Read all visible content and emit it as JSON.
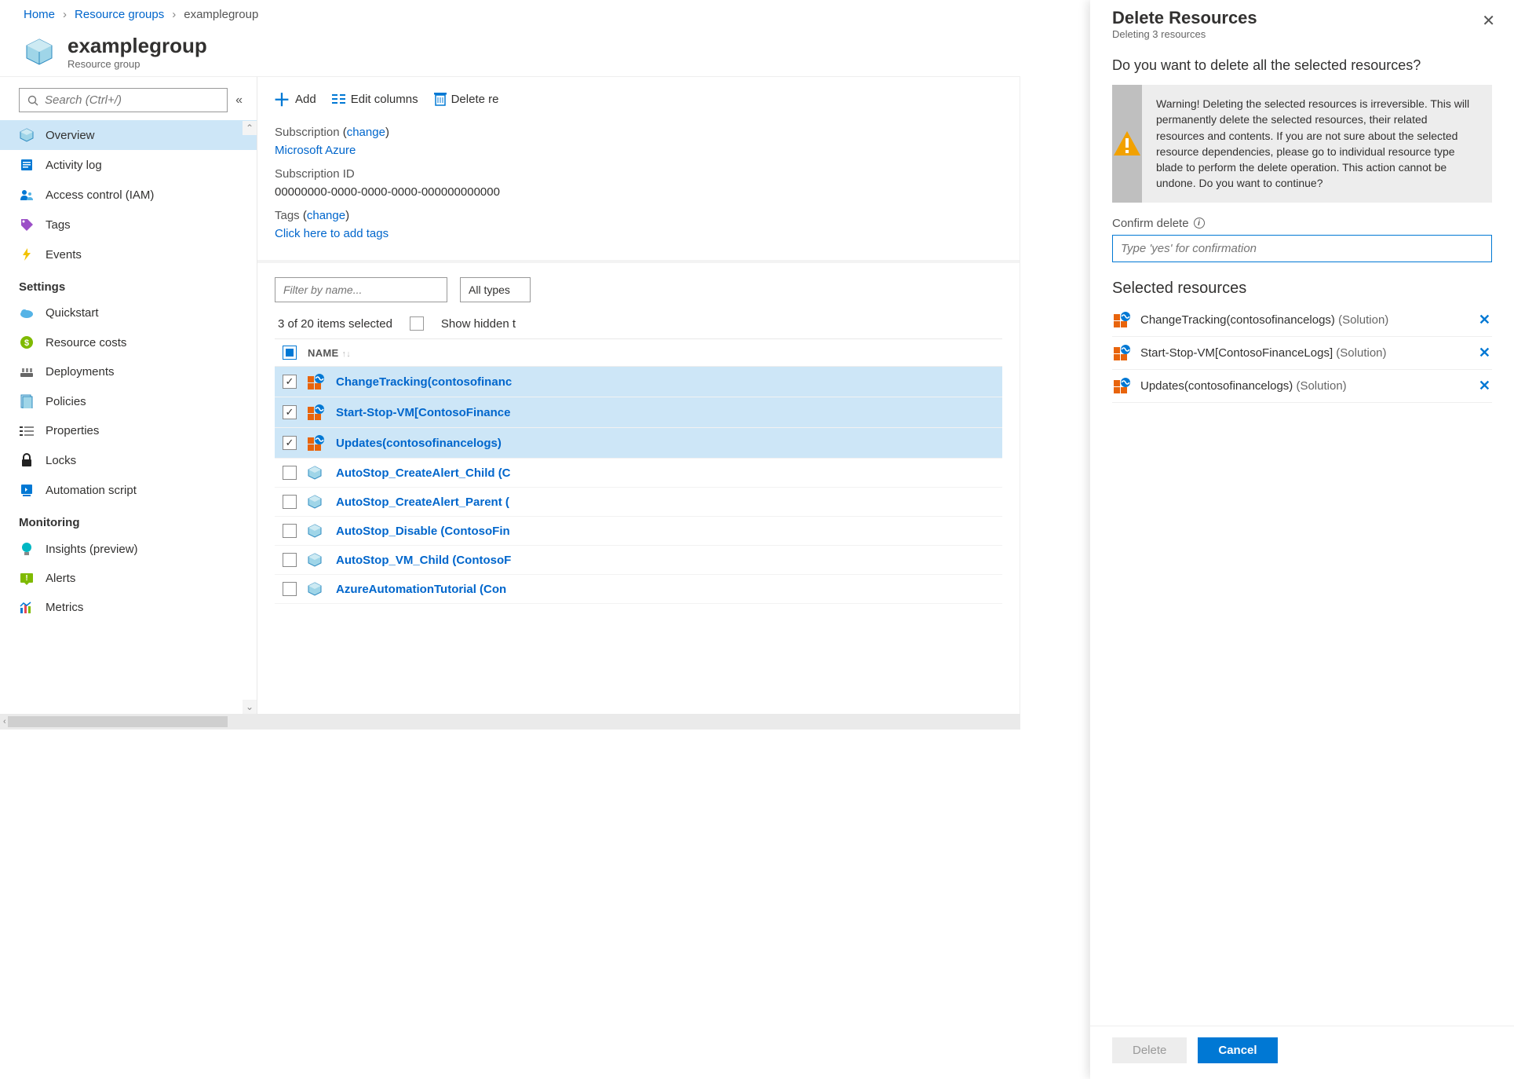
{
  "breadcrumb": {
    "home": "Home",
    "rg": "Resource groups",
    "current": "examplegroup"
  },
  "header": {
    "title": "examplegroup",
    "subtitle": "Resource group"
  },
  "search": {
    "placeholder": "Search (Ctrl+/)"
  },
  "sidebar": {
    "items": [
      {
        "icon": "cube",
        "label": "Overview",
        "active": true
      },
      {
        "icon": "log",
        "label": "Activity log"
      },
      {
        "icon": "iam",
        "label": "Access control (IAM)"
      },
      {
        "icon": "tag",
        "label": "Tags"
      },
      {
        "icon": "bolt",
        "label": "Events"
      }
    ],
    "settings_header": "Settings",
    "settings": [
      {
        "icon": "cloud",
        "label": "Quickstart"
      },
      {
        "icon": "cost",
        "label": "Resource costs"
      },
      {
        "icon": "deploy",
        "label": "Deployments"
      },
      {
        "icon": "policy",
        "label": "Policies"
      },
      {
        "icon": "props",
        "label": "Properties"
      },
      {
        "icon": "lock",
        "label": "Locks"
      },
      {
        "icon": "script",
        "label": "Automation script"
      }
    ],
    "monitoring_header": "Monitoring",
    "monitoring": [
      {
        "icon": "bulb",
        "label": "Insights (preview)"
      },
      {
        "icon": "alert",
        "label": "Alerts"
      },
      {
        "icon": "metrics",
        "label": "Metrics"
      }
    ]
  },
  "toolbar": {
    "add": "Add",
    "edit_columns": "Edit columns",
    "delete": "Delete re"
  },
  "meta": {
    "sub_label": "Subscription",
    "change": "change",
    "sub_value": "Microsoft Azure",
    "subid_label": "Subscription ID",
    "subid_value": "00000000-0000-0000-0000-000000000000",
    "tags_label": "Tags",
    "tags_value": "Click here to add tags"
  },
  "list": {
    "filter_placeholder": "Filter by name...",
    "types_dd": "All types",
    "selected_text": "3 of 20 items selected",
    "show_hidden": "Show hidden t",
    "col_name": "NAME",
    "rows": [
      {
        "selected": true,
        "icon": "solution",
        "name": "ChangeTracking(contosofinanc"
      },
      {
        "selected": true,
        "icon": "solution",
        "name": "Start-Stop-VM[ContosoFinance"
      },
      {
        "selected": true,
        "icon": "solution",
        "name": "Updates(contosofinancelogs)"
      },
      {
        "selected": false,
        "icon": "cube",
        "name": "AutoStop_CreateAlert_Child (C"
      },
      {
        "selected": false,
        "icon": "cube",
        "name": "AutoStop_CreateAlert_Parent ("
      },
      {
        "selected": false,
        "icon": "cube",
        "name": "AutoStop_Disable (ContosoFin"
      },
      {
        "selected": false,
        "icon": "cube",
        "name": "AutoStop_VM_Child (ContosoF"
      },
      {
        "selected": false,
        "icon": "cube",
        "name": "AzureAutomationTutorial (Con"
      }
    ]
  },
  "panel": {
    "title": "Delete Resources",
    "subtitle": "Deleting 3 resources",
    "question": "Do you want to delete all the selected resources?",
    "warning": "Warning! Deleting the selected resources is irreversible. This will permanently delete the selected resources, their related resources and contents. If you are not sure about the selected resource dependencies, please go to individual resource type blade to perform the delete operation. This action cannot be undone. Do you want to continue?",
    "confirm_label": "Confirm delete",
    "confirm_placeholder": "Type 'yes' for confirmation",
    "selected_header": "Selected resources",
    "selected": [
      {
        "name": "ChangeTracking(contosofinancelogs)",
        "type": "(Solution)"
      },
      {
        "name": "Start-Stop-VM[ContosoFinanceLogs]",
        "type": "(Solution)"
      },
      {
        "name": "Updates(contosofinancelogs)",
        "type": "(Solution)"
      }
    ],
    "delete_btn": "Delete",
    "cancel_btn": "Cancel"
  }
}
